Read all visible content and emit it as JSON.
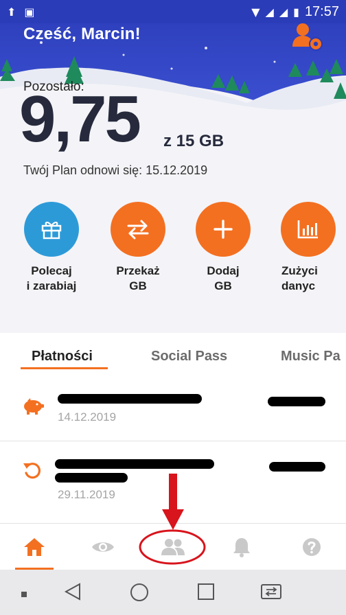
{
  "status_bar": {
    "time": "17:57",
    "icons": [
      "upload-icon",
      "gallery-icon",
      "wifi-icon",
      "signal-icon",
      "battery-icon"
    ]
  },
  "header": {
    "greeting": "Cześć, Marcin!"
  },
  "data_usage": {
    "remaining_label": "Pozostało:",
    "value": "9,75",
    "of_total": "z 15 GB",
    "renew_text": "Twój Plan odnowi się: 15.12.2019"
  },
  "actions": [
    {
      "label": "Polecaj\ni zarabiaj",
      "icon": "gift-icon",
      "color": "#2d9ad8"
    },
    {
      "label": "Przekaż\nGB",
      "icon": "transfer-icon",
      "color": "#f37021"
    },
    {
      "label": "Dodaj\nGB",
      "icon": "plus-icon",
      "color": "#f37021"
    },
    {
      "label": "Zużyci\ndanyc",
      "icon": "chart-icon",
      "color": "#f37021"
    }
  ],
  "tabs": [
    {
      "label": "Płatności",
      "active": true
    },
    {
      "label": "Social Pass",
      "active": false
    },
    {
      "label": "Music Pa",
      "active": false
    }
  ],
  "payments": [
    {
      "icon": "piggy-bank-icon",
      "date": "14.12.2019"
    },
    {
      "icon": "refund-icon",
      "date": "29.11.2019"
    }
  ],
  "bottom_nav": [
    "home-icon",
    "eye-icon",
    "people-icon",
    "bell-icon",
    "help-icon"
  ],
  "colors": {
    "accent": "#f37021",
    "blue": "#2d9ad8",
    "header": "#2b3cb8",
    "annotation": "#d8141c"
  }
}
